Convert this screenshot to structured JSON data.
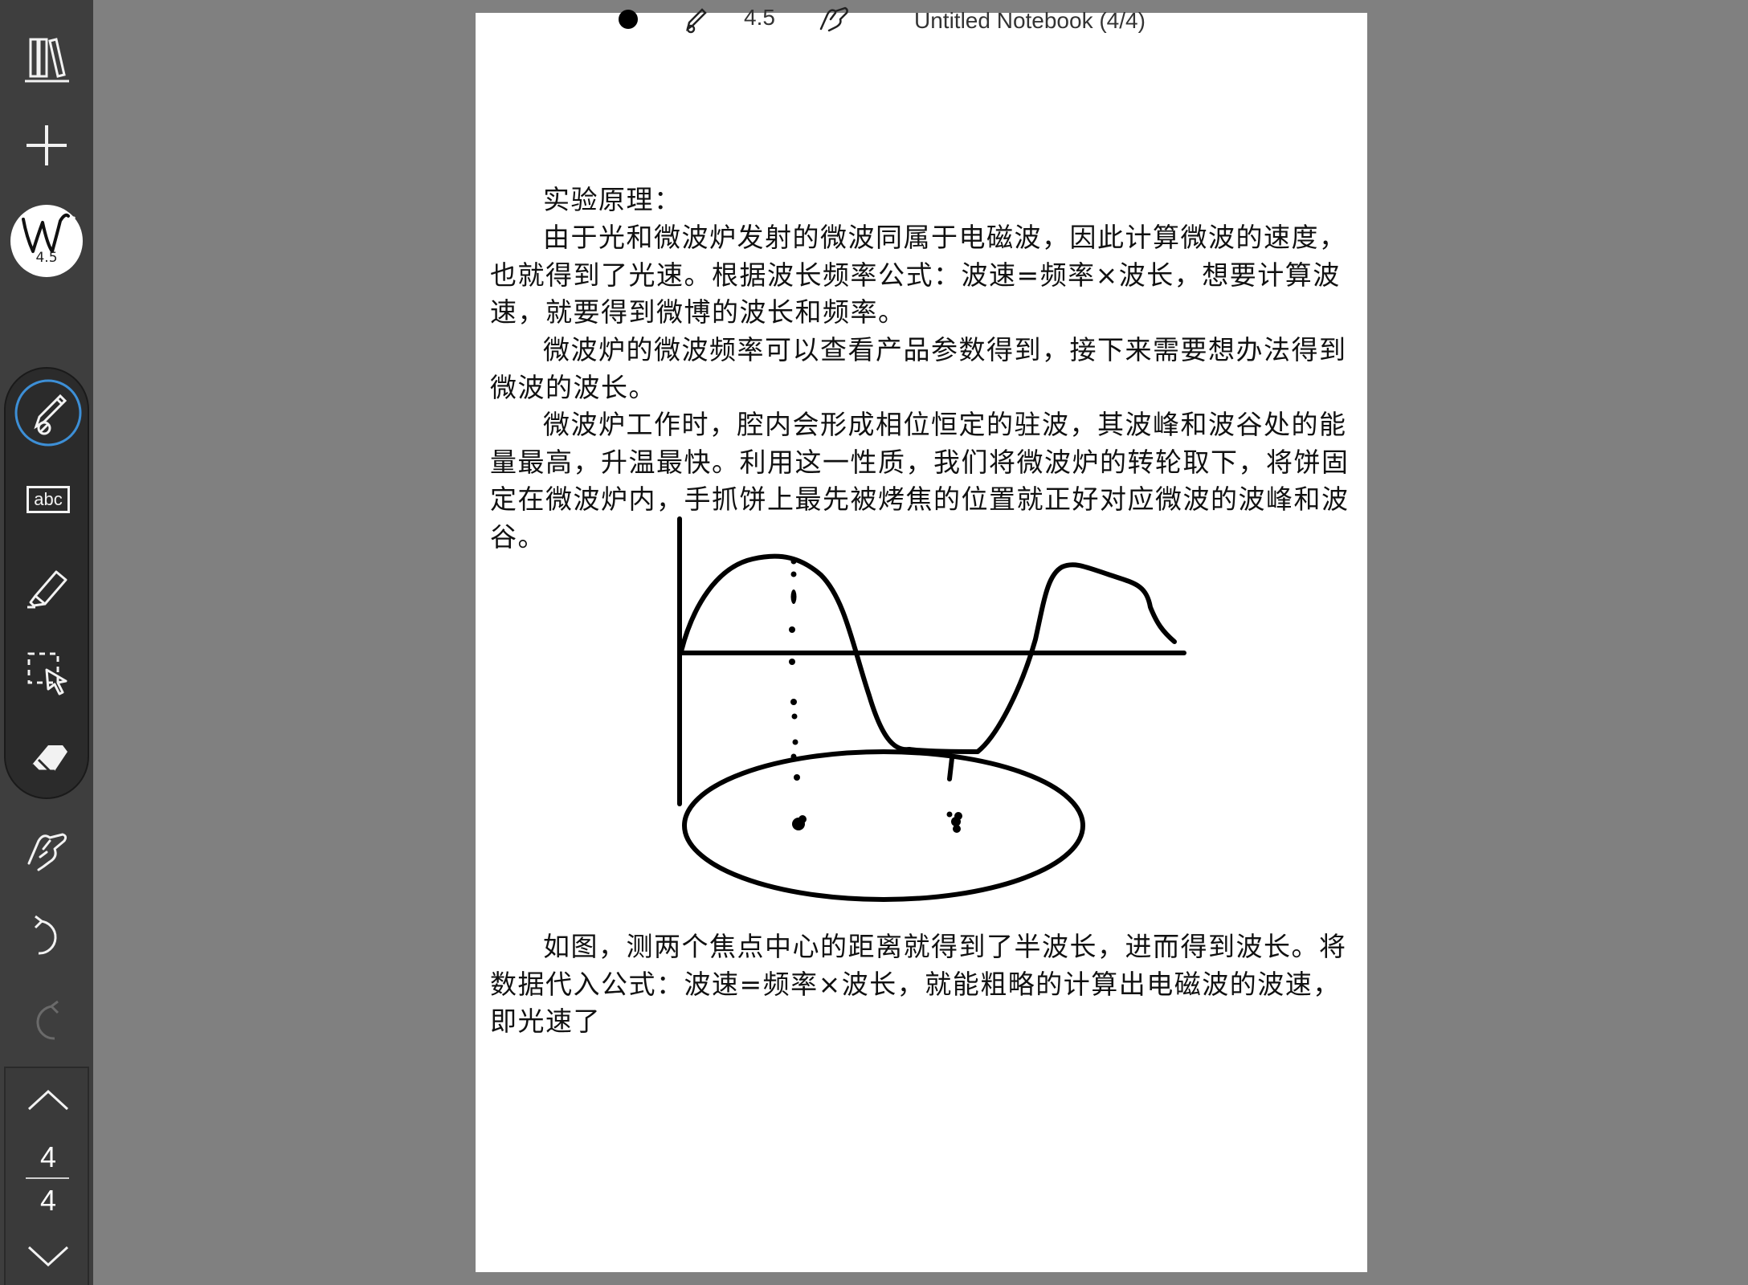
{
  "app": {
    "notebook_title": "Untitled Notebook (4/4)"
  },
  "toolbar": {
    "pen_size": "4.5",
    "topbar_pen_size": "4.5",
    "text_tool_label": "abc",
    "tools": [
      {
        "name": "library-icon"
      },
      {
        "name": "add-icon"
      },
      {
        "name": "reading-glasses-icon"
      },
      {
        "name": "pen-style-icon"
      },
      {
        "name": "pen-tool-icon"
      },
      {
        "name": "text-tool-icon"
      },
      {
        "name": "highlighter-icon"
      },
      {
        "name": "lasso-select-icon"
      },
      {
        "name": "eraser-icon"
      },
      {
        "name": "hand-tool-icon"
      },
      {
        "name": "undo-icon"
      },
      {
        "name": "redo-icon"
      }
    ]
  },
  "pager": {
    "current_page": "4",
    "total_pages": "4"
  },
  "content": {
    "heading": "实验原理：",
    "paragraphs": [
      "由于光和微波炉发射的微波同属于电磁波，因此计算微波的速度，也就得到了光速。根据波长频率公式：波速=频率×波长，想要计算波速，就要得到微博的波长和频率。",
      "微波炉的微波频率可以查看产品参数得到，接下来需要想办法得到微波的波长。",
      "微波炉工作时，腔内会形成相位恒定的驻波，其波峰和波谷处的能量最高，升温最快。利用这一性质，我们将微波炉的转轮取下，将饼固定在微波炉内，手抓饼上最先被烤焦的位置就正好对应微波的波峰和波谷。",
      "如图，测两个焦点中心的距离就得到了半波长，进而得到波长。将数据代入公式：波速=频率×波长，就能粗略的计算出电磁波的波速，即光速了"
    ]
  },
  "colors": {
    "background": "#808080",
    "sidebar": "#3e3e3e",
    "tool_group": "#2b2b2b",
    "active_ring": "#3d8fd6",
    "ink": "#000000"
  }
}
